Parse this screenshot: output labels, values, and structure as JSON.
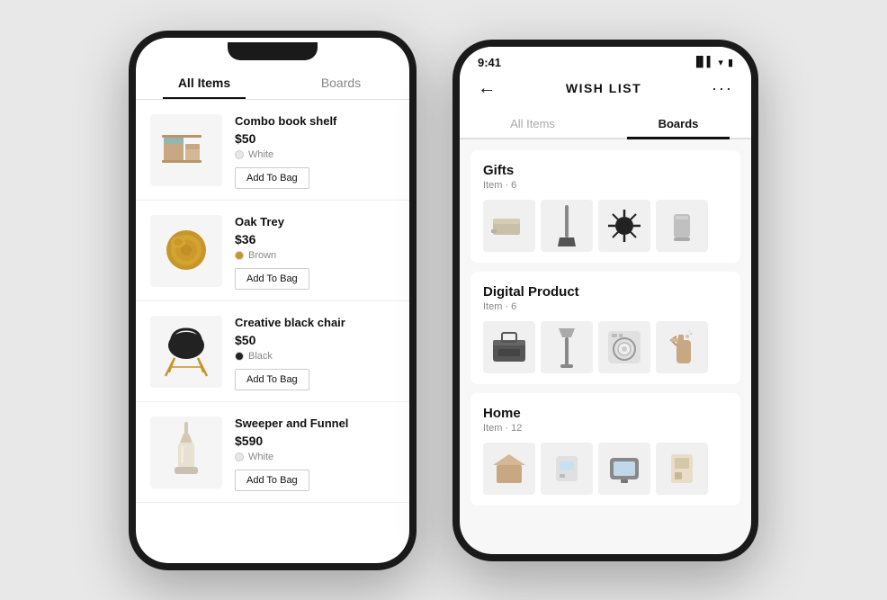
{
  "left_phone": {
    "tabs": [
      {
        "label": "All Items",
        "active": true
      },
      {
        "label": "Boards",
        "active": false
      }
    ],
    "products": [
      {
        "name": "Combo book shelf",
        "price": "$50",
        "color": "White",
        "color_type": "white",
        "btn_label": "Add To Bag"
      },
      {
        "name": "Oak Trey",
        "price": "$36",
        "color": "Brown",
        "color_type": "brown",
        "btn_label": "Add To Bag"
      },
      {
        "name": "Creative black chair",
        "price": "$50",
        "color": "Black",
        "color_type": "black",
        "btn_label": "Add To Bag"
      },
      {
        "name": "Sweeper and Funnel",
        "price": "$590",
        "color": "White",
        "color_type": "white",
        "btn_label": "Add To Bag"
      }
    ]
  },
  "right_phone": {
    "status_time": "9:41",
    "nav_title": "WISH LIST",
    "tabs": [
      {
        "label": "All Items",
        "active": false
      },
      {
        "label": "Boards",
        "active": true
      }
    ],
    "boards": [
      {
        "title": "Gifts",
        "item_count": "Item · 6"
      },
      {
        "title": "Digital Product",
        "item_count": "Item · 6"
      },
      {
        "title": "Home",
        "item_count": "Item · 12"
      }
    ]
  }
}
